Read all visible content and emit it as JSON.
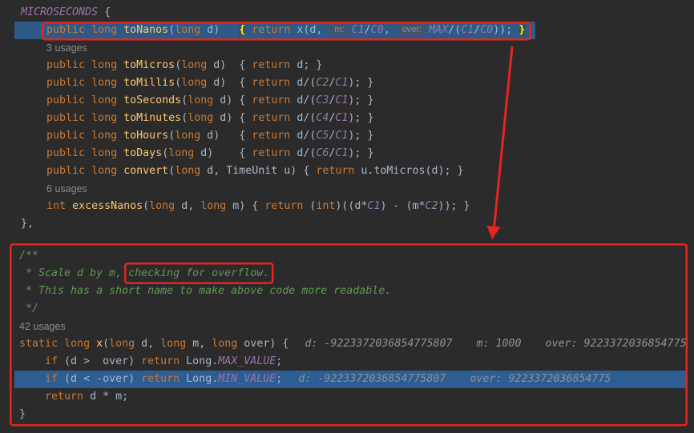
{
  "palette": {
    "background": "#2b2b2b",
    "default_text": "#a9b7c6",
    "keyword": "#cc7832",
    "method_declaration": "#ffc66d",
    "constant": "#9876aa",
    "comment": "#629755",
    "usages_hint": "#8c8c8c",
    "inlay_hint_text": "#8c8f94",
    "inlay_hint_bg": "#44556b",
    "brace_match_text": "#ffef28",
    "brace_match_bg": "#3b514d",
    "debug_value": "#8e9297",
    "frame_line_bg": "#2e5a87",
    "execution_line_bg": "#2d5d92",
    "annotation_red": "#e52520"
  },
  "upper": {
    "lines": [
      {
        "tokens": [
          {
            "cn": "MICROSECONDS"
          },
          {
            "tx": " {"
          }
        ]
      },
      {
        "current_frame": true,
        "tokens": [
          {
            "tx": "    "
          },
          {
            "kw": "public"
          },
          {
            "tx": " "
          },
          {
            "kw": "long"
          },
          {
            "tx": " "
          },
          {
            "fn": "toNanos"
          },
          {
            "tx": "("
          },
          {
            "kw": "long"
          },
          {
            "tx": " d)   "
          },
          {
            "br": "{"
          },
          {
            "tx": " "
          },
          {
            "kw": "return"
          },
          {
            "tx": " x(d, "
          },
          {
            "hint": "m:"
          },
          {
            "cn": "C1"
          },
          {
            "tx": "/"
          },
          {
            "cn": "C0"
          },
          {
            "tx": ", "
          },
          {
            "hint": "over:"
          },
          {
            "cn": "MAX"
          },
          {
            "tx": "/("
          },
          {
            "cn": "C1"
          },
          {
            "tx": "/"
          },
          {
            "cn": "C0"
          },
          {
            "tx": ")); "
          },
          {
            "br": "}"
          }
        ]
      },
      {
        "usage": "3 usages"
      },
      {
        "tokens": [
          {
            "tx": "    "
          },
          {
            "kw": "public"
          },
          {
            "tx": " "
          },
          {
            "kw": "long"
          },
          {
            "tx": " "
          },
          {
            "fn": "toMicros"
          },
          {
            "tx": "("
          },
          {
            "kw": "long"
          },
          {
            "tx": " d)  { "
          },
          {
            "kw": "return"
          },
          {
            "tx": " d; }"
          }
        ]
      },
      {
        "tokens": [
          {
            "tx": "    "
          },
          {
            "kw": "public"
          },
          {
            "tx": " "
          },
          {
            "kw": "long"
          },
          {
            "tx": " "
          },
          {
            "fn": "toMillis"
          },
          {
            "tx": "("
          },
          {
            "kw": "long"
          },
          {
            "tx": " d)  { "
          },
          {
            "kw": "return"
          },
          {
            "tx": " d/("
          },
          {
            "cn": "C2"
          },
          {
            "tx": "/"
          },
          {
            "cn": "C1"
          },
          {
            "tx": "); }"
          }
        ]
      },
      {
        "tokens": [
          {
            "tx": "    "
          },
          {
            "kw": "public"
          },
          {
            "tx": " "
          },
          {
            "kw": "long"
          },
          {
            "tx": " "
          },
          {
            "fn": "toSeconds"
          },
          {
            "tx": "("
          },
          {
            "kw": "long"
          },
          {
            "tx": " d) { "
          },
          {
            "kw": "return"
          },
          {
            "tx": " d/("
          },
          {
            "cn": "C3"
          },
          {
            "tx": "/"
          },
          {
            "cn": "C1"
          },
          {
            "tx": "); }"
          }
        ]
      },
      {
        "tokens": [
          {
            "tx": "    "
          },
          {
            "kw": "public"
          },
          {
            "tx": " "
          },
          {
            "kw": "long"
          },
          {
            "tx": " "
          },
          {
            "fn": "toMinutes"
          },
          {
            "tx": "("
          },
          {
            "kw": "long"
          },
          {
            "tx": " d) { "
          },
          {
            "kw": "return"
          },
          {
            "tx": " d/("
          },
          {
            "cn": "C4"
          },
          {
            "tx": "/"
          },
          {
            "cn": "C1"
          },
          {
            "tx": "); }"
          }
        ]
      },
      {
        "tokens": [
          {
            "tx": "    "
          },
          {
            "kw": "public"
          },
          {
            "tx": " "
          },
          {
            "kw": "long"
          },
          {
            "tx": " "
          },
          {
            "fn": "toHours"
          },
          {
            "tx": "("
          },
          {
            "kw": "long"
          },
          {
            "tx": " d)   { "
          },
          {
            "kw": "return"
          },
          {
            "tx": " d/("
          },
          {
            "cn": "C5"
          },
          {
            "tx": "/"
          },
          {
            "cn": "C1"
          },
          {
            "tx": "); }"
          }
        ]
      },
      {
        "tokens": [
          {
            "tx": "    "
          },
          {
            "kw": "public"
          },
          {
            "tx": " "
          },
          {
            "kw": "long"
          },
          {
            "tx": " "
          },
          {
            "fn": "toDays"
          },
          {
            "tx": "("
          },
          {
            "kw": "long"
          },
          {
            "tx": " d)    { "
          },
          {
            "kw": "return"
          },
          {
            "tx": " d/("
          },
          {
            "cn": "C6"
          },
          {
            "tx": "/"
          },
          {
            "cn": "C1"
          },
          {
            "tx": "); }"
          }
        ]
      },
      {
        "tokens": [
          {
            "tx": "    "
          },
          {
            "kw": "public"
          },
          {
            "tx": " "
          },
          {
            "kw": "long"
          },
          {
            "tx": " "
          },
          {
            "fn": "convert"
          },
          {
            "tx": "("
          },
          {
            "kw": "long"
          },
          {
            "tx": " d, TimeUnit u) { "
          },
          {
            "kw": "return"
          },
          {
            "tx": " u.toMicros(d); }"
          }
        ]
      },
      {
        "usage": "6 usages"
      },
      {
        "tokens": [
          {
            "tx": "    "
          },
          {
            "kw": "int"
          },
          {
            "tx": " "
          },
          {
            "fn": "excessNanos"
          },
          {
            "tx": "("
          },
          {
            "kw": "long"
          },
          {
            "tx": " d, "
          },
          {
            "kw": "long"
          },
          {
            "tx": " m) { "
          },
          {
            "kw": "return"
          },
          {
            "tx": " ("
          },
          {
            "kw": "int"
          },
          {
            "tx": ")((d*"
          },
          {
            "cn": "C1"
          },
          {
            "tx": ") - (m*"
          },
          {
            "cn": "C2"
          },
          {
            "tx": ")); }"
          }
        ]
      },
      {
        "tokens": [
          {
            "tx": "},"
          }
        ]
      }
    ]
  },
  "lower": {
    "lines": [
      {
        "tokens": [
          {
            "cm": "/**"
          }
        ]
      },
      {
        "tokens": [
          {
            "cm": " * Scale d by m, "
          },
          {
            "cm": "checking for overflow."
          }
        ]
      },
      {
        "tokens": [
          {
            "cm": " * This has a short name to make above code more readable."
          }
        ]
      },
      {
        "tokens": [
          {
            "cm": " */"
          }
        ]
      },
      {
        "usage": "42 usages"
      },
      {
        "tokens": [
          {
            "kw": "static"
          },
          {
            "tx": " "
          },
          {
            "kw": "long"
          },
          {
            "tx": " "
          },
          {
            "fn": "x"
          },
          {
            "tx": "("
          },
          {
            "kw": "long"
          },
          {
            "tx": " d, "
          },
          {
            "kw": "long"
          },
          {
            "tx": " m, "
          },
          {
            "kw": "long"
          },
          {
            "tx": " over) {"
          },
          {
            "dv": "d: -9223372036854775807"
          },
          {
            "dv": "m: 1000"
          },
          {
            "dv": "over: 9223372036854775"
          }
        ]
      },
      {
        "tokens": [
          {
            "tx": "    "
          },
          {
            "kw": "if"
          },
          {
            "tx": " (d >  over) "
          },
          {
            "kw": "return"
          },
          {
            "tx": " Long."
          },
          {
            "cn": "MAX_VALUE"
          },
          {
            "tx": ";"
          }
        ]
      },
      {
        "execution_point": true,
        "tokens": [
          {
            "tx": "    "
          },
          {
            "kw": "if"
          },
          {
            "tx": " (d < -over) "
          },
          {
            "kw": "return"
          },
          {
            "tx": " Long."
          },
          {
            "cn": "MIN_VALUE"
          },
          {
            "tx": ";"
          },
          {
            "dv": "d: -9223372036854775807"
          },
          {
            "dv": "over: 9223372036854775"
          }
        ]
      },
      {
        "tokens": [
          {
            "tx": "    "
          },
          {
            "kw": "return"
          },
          {
            "tx": " d * m;"
          }
        ]
      },
      {
        "tokens": [
          {
            "tx": "}"
          }
        ]
      }
    ]
  }
}
